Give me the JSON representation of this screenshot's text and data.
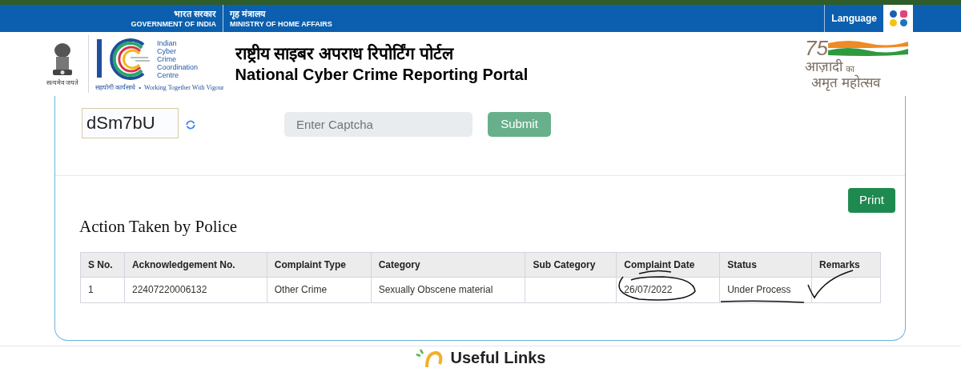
{
  "topbar": {
    "gov_hindi": "भारत सरकार",
    "gov_english": "GOVERNMENT OF INDIA",
    "ministry_hindi": "गृह मंत्रालय",
    "ministry_english": "MINISTRY OF HOME AFFAIRS",
    "language": "Language"
  },
  "header": {
    "emblem_motto": "सत्यमेव जयते",
    "i4c_lines": [
      "Indian",
      "Cyber",
      "Crime",
      "Coordination",
      "Centre"
    ],
    "i4c_tagline_hindi": "सहयोगी कार्यसाधे",
    "i4c_separator": "•",
    "i4c_tagline": "Working Together With Vigour",
    "title_hindi": "राष्ट्रीय साइबर अपराध रिपोर्टिंग पोर्टल",
    "title_english": "National Cyber Crime Reporting Portal",
    "azadi_number": "75",
    "azadi_line1": "आज़ादी",
    "azadi_ka": "का",
    "azadi_line2": "अमृत महोत्सव"
  },
  "captcha": {
    "code": "dSm7bU",
    "placeholder": "Enter Captcha",
    "submit": "Submit"
  },
  "print": "Print",
  "section_title": "Action Taken by Police",
  "table": {
    "columns": [
      "S No.",
      "Acknowledgement No.",
      "Complaint Type",
      "Category",
      "Sub Category",
      "Complaint Date",
      "Status",
      "Remarks"
    ],
    "rows": [
      [
        "1",
        "22407220006132",
        "Other Crime",
        "Sexually Obscene material",
        "",
        "26/07/2022",
        "Under Process",
        ""
      ]
    ]
  },
  "useful_links": "Useful Links"
}
